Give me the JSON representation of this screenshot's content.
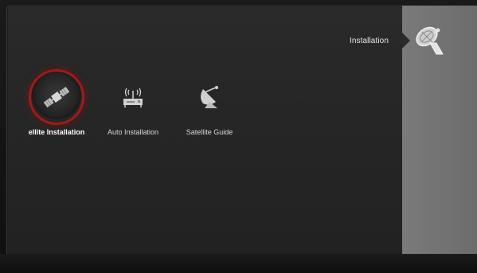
{
  "header": {
    "title": "Installation",
    "section_icon": "satellite-dish-icon"
  },
  "menu": {
    "items": [
      {
        "label": "ellite Installation",
        "icon": "satellite-icon",
        "selected": true
      },
      {
        "label": "Auto Installation",
        "icon": "antenna-receiver-icon",
        "selected": false
      },
      {
        "label": "Satellite Guide",
        "icon": "dish-guide-icon",
        "selected": false
      }
    ]
  },
  "colors": {
    "selection_ring": "#a11a1a",
    "panel": "#262626",
    "strip": "#707070"
  }
}
